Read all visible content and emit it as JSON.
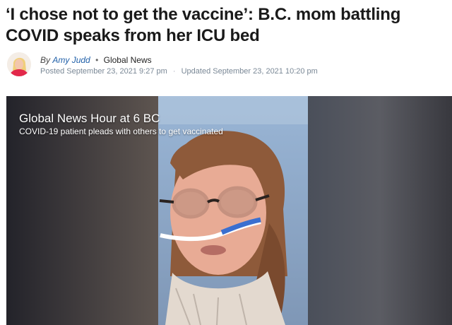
{
  "article": {
    "headline": "‘I chose not to get the vaccine’: B.C. mom battling COVID speaks from her ICU bed",
    "byline": {
      "by_label": "By",
      "author": "Amy Judd",
      "separator": "•",
      "outlet": "Global News",
      "posted": "Posted September 23, 2021 9:27 pm",
      "dot": "·",
      "updated": "Updated September 23, 2021 10:20 pm"
    }
  },
  "video": {
    "title": "Global News Hour at 6 BC",
    "subtitle": "COVID-19 patient pleads with others to get vaccinated"
  },
  "colors": {
    "author_link": "#1f5fa8",
    "headline": "#1a1a1a",
    "meta": "#7a8896"
  }
}
